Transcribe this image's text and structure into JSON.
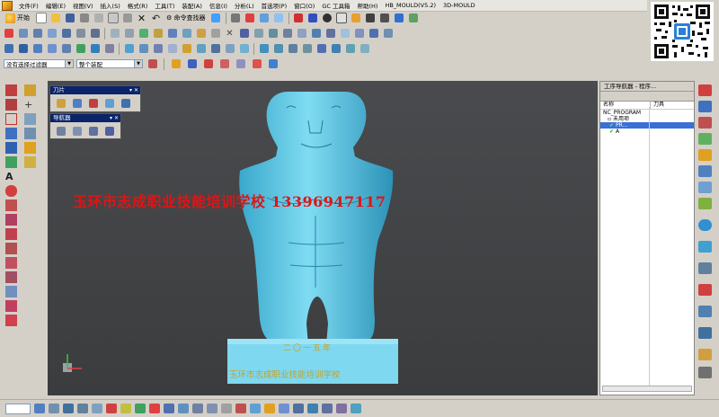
{
  "menubar": {
    "items": [
      "文件(F)",
      "编辑(E)",
      "视图(V)",
      "插入(S)",
      "格式(R)",
      "工具(T)",
      "装配(A)",
      "信息(I)",
      "分析(L)",
      "首选项(P)",
      "窗口(O)",
      "GC 工具箱",
      "帮助(H)",
      "HB_MOULD(V5.2)",
      "3D-MOULD"
    ]
  },
  "toolbar": {
    "start_label": "开始",
    "command_finder_label": "命令查找器"
  },
  "selection": {
    "filter_value": "没有选择过滤器",
    "scope_value": "整个装配"
  },
  "panels": {
    "tool_title": "刀片",
    "navigator_title": "导航器"
  },
  "viewport": {
    "watermark": "玉环市志成职业技能培训学校  13396947117",
    "pedestal_line1": "二〇一五年",
    "pedestal_line2": "玉环市志成职业技能培训学校",
    "model_color": "#5fc8e6",
    "pedestal_color": "#7ed8f0",
    "watermark_color": "#e21313"
  },
  "operation_navigator": {
    "title": "工序导航器 - 程序...",
    "col_name": "名称",
    "col_tool": "刀具",
    "rows": [
      "NC_PROGRAM",
      "未用项",
      "PR...",
      "A"
    ]
  }
}
